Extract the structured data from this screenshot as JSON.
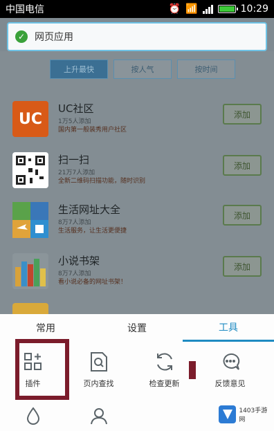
{
  "statusbar": {
    "carrier": "中国电信",
    "time": "10:29"
  },
  "toast": {
    "text": "网页应用"
  },
  "content": {
    "tabs": [
      "上升最快",
      "按人气",
      "按时间"
    ],
    "apps": [
      {
        "name": "UC社区",
        "sub": "1万5人添加",
        "desc": "国内第一般装秀用户社区",
        "button": "添加",
        "icon_text": "UC"
      },
      {
        "name": "扫一扫",
        "sub": "21万7人添加",
        "desc": "全新二维码扫描功能，随时识别",
        "button": "添加"
      },
      {
        "name": "生活网址大全",
        "sub": "8万7人添加",
        "desc": "生活服务，让生活更便捷",
        "button": "添加"
      },
      {
        "name": "小说书架",
        "sub": "8万7人添加",
        "desc": "看小说必备的网址书架！",
        "button": "添加"
      }
    ]
  },
  "sheet": {
    "tabs": [
      "常用",
      "设置",
      "工具"
    ],
    "active_tab": "工具",
    "tools": [
      {
        "label": "插件",
        "icon": "plugin-icon"
      },
      {
        "label": "页内查找",
        "icon": "find-in-page-icon"
      },
      {
        "label": "检查更新",
        "icon": "refresh-icon"
      },
      {
        "label": "反馈意见",
        "icon": "feedback-icon"
      }
    ]
  },
  "watermark": {
    "text": "1403手游网"
  },
  "colors": {
    "accent": "#1f8bc2",
    "highlight": "#7b1c2b"
  }
}
